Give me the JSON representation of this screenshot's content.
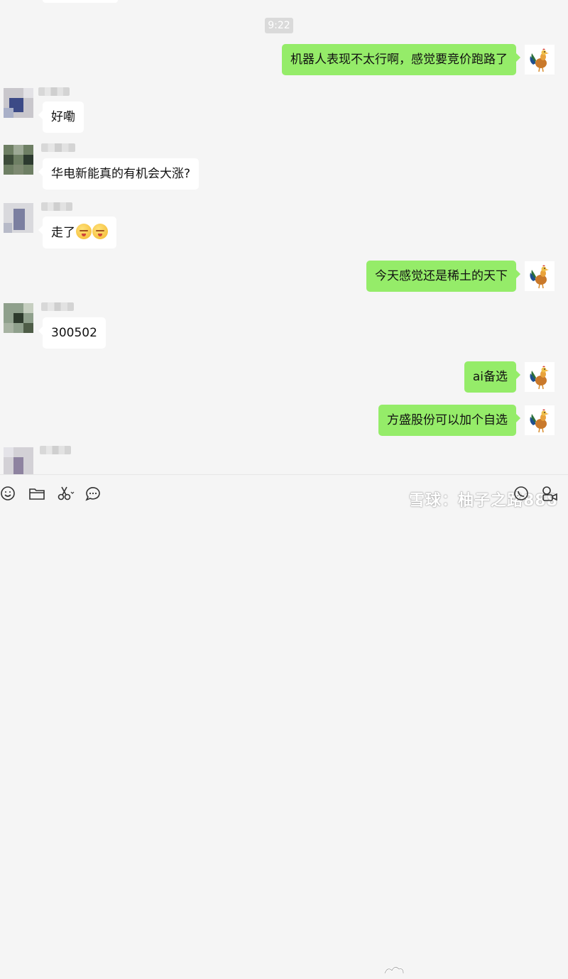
{
  "chat": {
    "timestamp": "9:22",
    "messages": [
      {
        "side": "right",
        "text": "机器人表现不太行啊，感觉要竞价跑路了"
      },
      {
        "side": "left",
        "text": "好嘞"
      },
      {
        "side": "left",
        "text": "华电新能真的有机会大涨?"
      },
      {
        "side": "left",
        "text": "走了",
        "emojis": 2
      },
      {
        "side": "right",
        "text": "今天感觉还是稀土的天下"
      },
      {
        "side": "left",
        "text": "300502"
      },
      {
        "side": "right",
        "text": "ai备选"
      },
      {
        "side": "right",
        "text": "方盛股份可以加个自选"
      }
    ]
  },
  "toolbar": {
    "icons": [
      "emoji-icon",
      "folder-icon",
      "scissors-icon",
      "chat-bubble-icon",
      "voice-call-icon",
      "video-call-icon"
    ]
  },
  "watermark": {
    "text": "雪球：柚子之路888"
  },
  "colors": {
    "background": "#f5f5f5",
    "my_bubble": "#95ec69",
    "their_bubble": "#ffffff",
    "timestamp_bg": "#dadada"
  }
}
